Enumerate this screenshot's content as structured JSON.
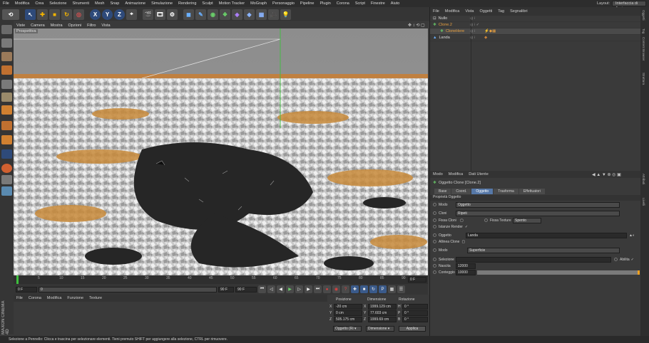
{
  "menubar": {
    "items": [
      "File",
      "Modifica",
      "Crea",
      "Selezione",
      "Strumenti",
      "Mesh",
      "Snap",
      "Animazione",
      "Simulazione",
      "Rendering",
      "Sculpt",
      "Motion Tracker",
      "MoGraph",
      "Personaggio",
      "Pipeline",
      "Plugin",
      "Corona",
      "Script",
      "Finestre",
      "Aiuto"
    ],
    "layout_label": "Layout:",
    "layout_value": "Interfaccia di Avvio"
  },
  "toolbar": {
    "axis_x": "X",
    "axis_y": "Y",
    "axis_z": "Z"
  },
  "viewport": {
    "menu": [
      "Viste",
      "Camera",
      "Mostra",
      "Opzioni",
      "Filtro",
      "Vista"
    ],
    "label": "Prospettiva"
  },
  "timeline": {
    "ticks": [
      "0",
      "5",
      "10",
      "15",
      "20",
      "25",
      "30",
      "35",
      "40",
      "45",
      "50",
      "55",
      "60",
      "65",
      "70",
      "75",
      "80",
      "85",
      "90"
    ],
    "end_frame": "0 F"
  },
  "transport": {
    "start": "0 F",
    "current": "0",
    "end_a": "90 F",
    "end_b": "90 F"
  },
  "materials": {
    "menu": [
      "File",
      "Corona",
      "Modifica",
      "Funzione",
      "Texture"
    ]
  },
  "coords": {
    "headers": [
      "Posizione",
      "Dimensione",
      "Rotazione"
    ],
    "rows": [
      {
        "axis": "X",
        "pos": "-20 cm",
        "dim": "1999.129 cm",
        "rot_axis": "H",
        "rot": "0 °"
      },
      {
        "axis": "Y",
        "pos": "0 cm",
        "dim": "77.603 cm",
        "rot_axis": "P",
        "rot": "0 °"
      },
      {
        "axis": "Z",
        "pos": "505.175 cm",
        "dim": "1999.69 cm",
        "rot_axis": "B",
        "rot": "0 °"
      }
    ],
    "mode_a": "Oggetto (Ri ▾",
    "mode_b": "Dimensione ▾",
    "apply": "Applica"
  },
  "objects": {
    "menu": [
      "File",
      "Modifica",
      "Vista",
      "Oggetti",
      "Tag",
      "Segnalibri"
    ],
    "rows": [
      {
        "name": "Nullo",
        "color": "#d8d8d8"
      },
      {
        "name": "Clone.2",
        "color": "#e8a040"
      },
      {
        "name": "CloneHere",
        "color": "#e8a040"
      },
      {
        "name": "Landa",
        "color": "#d8d8d8"
      }
    ]
  },
  "attributes": {
    "menu": [
      "Modo",
      "Modifica",
      "Dati Utente"
    ],
    "title": "Oggetto Clone [Clone.2]",
    "tabs": [
      "Base",
      "Coord.",
      "Oggetto",
      "Trasforma",
      "Effettuatori"
    ],
    "section": "Proprietà Oggetto",
    "mode_label": "Modo",
    "mode_value": "Oggetto",
    "clones_label": "Cloni",
    "clones_value": "Ripeti",
    "fix_clone": "Fissa Cloni",
    "fix_texture": "Fissa Texture",
    "fix_texture_value": "Spento",
    "render_instances": "Istanze Render",
    "object_label": "Oggetto",
    "object_value": "Landa",
    "align_clone": "Allinea Clone",
    "distribution_label": "Modo",
    "distribution_value": "Superficie",
    "selection_label": "Selezione",
    "enable": "Abilita",
    "seed_label": "Nascita",
    "seed_value": "12000",
    "count_label": "Conteggio",
    "count_value": "10000"
  },
  "status": {
    "text": "Selezione a Pennello: Clicca e trascina per selezionare elementi. Tieni premuto SHIFT per aggiungere alla selezione, CTRL per rimuovere."
  },
  "right_strip": [
    "Oggetti",
    "Tag",
    "Content Browser",
    "Struttura",
    "Attributi",
    "Livelli"
  ],
  "logo": {
    "line1": "MAXON",
    "line2": "CINEMA 4D"
  }
}
